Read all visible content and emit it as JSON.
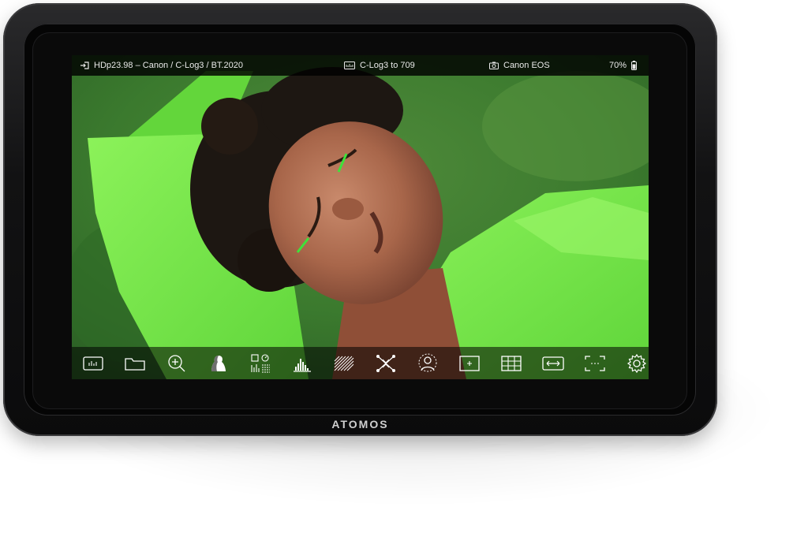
{
  "brand": "ATOMOS",
  "status_bar": {
    "input": "HDp23.98 – Canon / C-Log3 / BT.2020",
    "lut": "C-Log3 to 709",
    "camera": "Canon EOS",
    "battery": "70%"
  },
  "toolbar_icons": [
    "monitor-icon",
    "folder-icon",
    "zoom-icon",
    "false-color-icon",
    "scopes-icon",
    "histogram-icon",
    "zebra-icon",
    "focus-peaking-icon",
    "user-icon",
    "frame-guide-icon",
    "grid-icon",
    "anamorphic-icon",
    "crop-icon",
    "settings-icon"
  ]
}
